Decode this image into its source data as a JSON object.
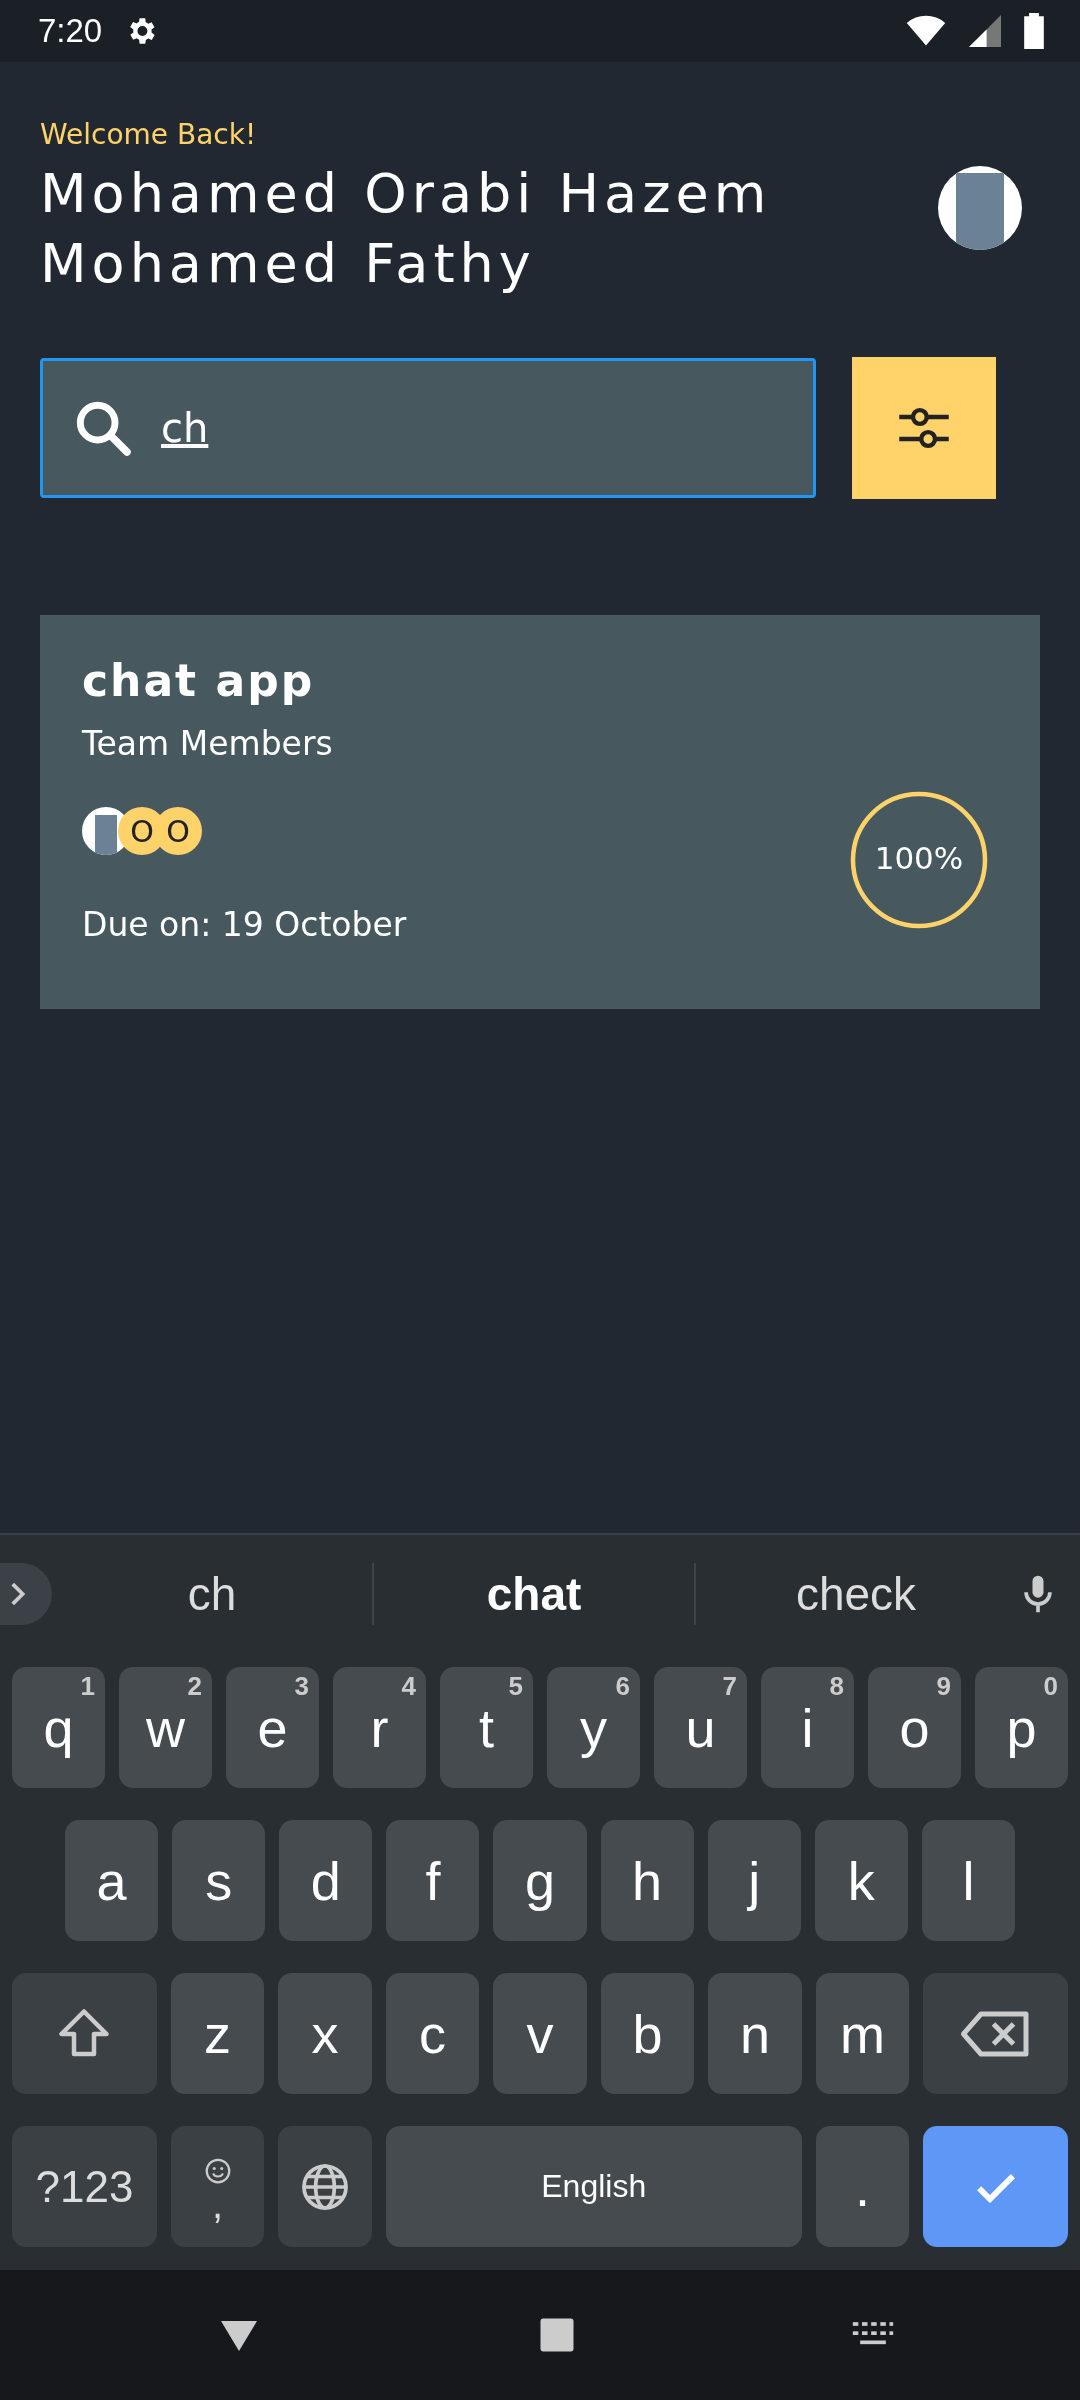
{
  "status_bar": {
    "time": "7:20"
  },
  "header": {
    "greeting": "Welcome Back!",
    "user_name": "Mohamed Orabi Hazem Mohamed Fathy"
  },
  "search": {
    "value": "ch",
    "focused": true
  },
  "projects": [
    {
      "title": "chat app",
      "members_label": "Team Members",
      "members": [
        {
          "kind": "photo"
        },
        {
          "kind": "initial",
          "initial": "O"
        },
        {
          "kind": "initial",
          "initial": "O"
        }
      ],
      "due": "Due on: 19 October",
      "progress": {
        "level": 1.0,
        "label": "100%"
      }
    }
  ],
  "keyboard": {
    "suggestions": [
      {
        "text": "ch",
        "selected": false
      },
      {
        "text": "chat",
        "selected": true
      },
      {
        "text": "check",
        "selected": false
      }
    ],
    "rows": [
      {
        "keys": [
          {
            "kind": "letter",
            "label": "q",
            "hint": "1"
          },
          {
            "kind": "letter",
            "label": "w",
            "hint": "2"
          },
          {
            "kind": "letter",
            "label": "e",
            "hint": "3"
          },
          {
            "kind": "letter",
            "label": "r",
            "hint": "4"
          },
          {
            "kind": "letter",
            "label": "t",
            "hint": "5"
          },
          {
            "kind": "letter",
            "label": "y",
            "hint": "6"
          },
          {
            "kind": "letter",
            "label": "u",
            "hint": "7"
          },
          {
            "kind": "letter",
            "label": "i",
            "hint": "8"
          },
          {
            "kind": "letter",
            "label": "o",
            "hint": "9"
          },
          {
            "kind": "letter",
            "label": "p",
            "hint": "0"
          }
        ]
      },
      {
        "keys": [
          {
            "kind": "letter",
            "label": "a"
          },
          {
            "kind": "letter",
            "label": "s"
          },
          {
            "kind": "letter",
            "label": "d"
          },
          {
            "kind": "letter",
            "label": "f"
          },
          {
            "kind": "letter",
            "label": "g"
          },
          {
            "kind": "letter",
            "label": "h"
          },
          {
            "kind": "letter",
            "label": "j"
          },
          {
            "kind": "letter",
            "label": "k"
          },
          {
            "kind": "letter",
            "label": "l"
          }
        ]
      },
      {
        "keys": [
          {
            "kind": "shift"
          },
          {
            "kind": "letter",
            "label": "z"
          },
          {
            "kind": "letter",
            "label": "x"
          },
          {
            "kind": "letter",
            "label": "c"
          },
          {
            "kind": "letter",
            "label": "v"
          },
          {
            "kind": "letter",
            "label": "b"
          },
          {
            "kind": "letter",
            "label": "n"
          },
          {
            "kind": "letter",
            "label": "m"
          },
          {
            "kind": "backspace"
          }
        ]
      },
      {
        "keys": [
          {
            "kind": "symbols",
            "label": "?123"
          },
          {
            "kind": "comma",
            "label": ","
          },
          {
            "kind": "globe"
          },
          {
            "kind": "space",
            "label": "English"
          },
          {
            "kind": "letter",
            "label": "."
          },
          {
            "kind": "enter"
          }
        ]
      }
    ]
  }
}
